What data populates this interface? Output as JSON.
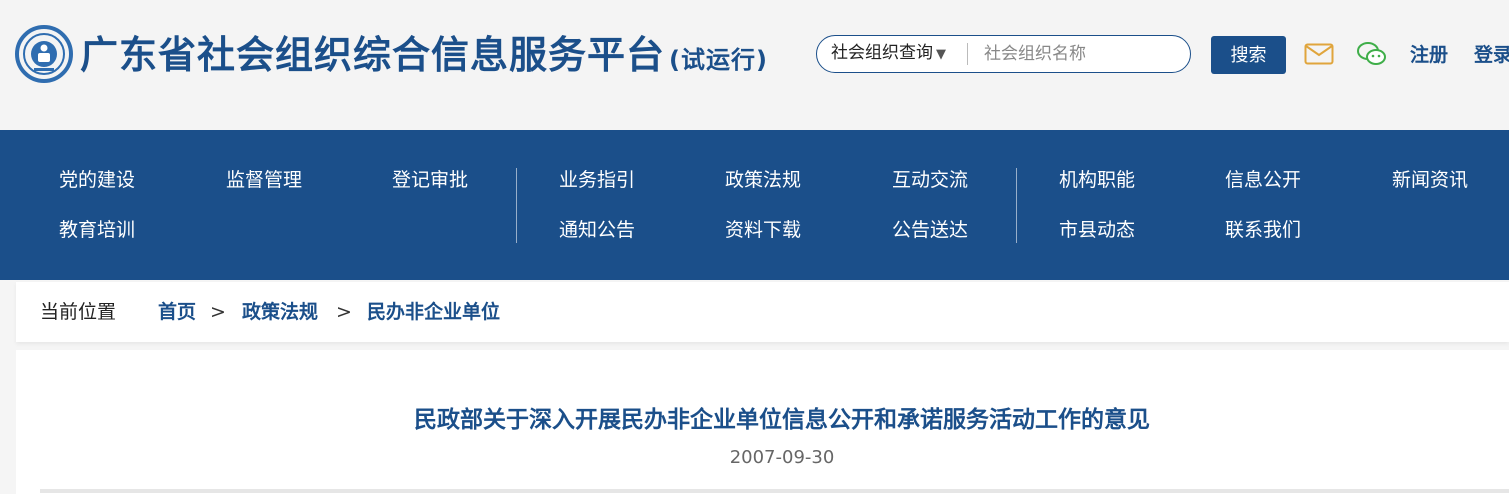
{
  "header": {
    "title": "广东省社会组织综合信息服务平台",
    "title_suffix": "(试运行)",
    "search": {
      "scope_label": "社会组织查询",
      "placeholder": "社会组织名称",
      "button_label": "搜索"
    },
    "icons": [
      "mail-icon",
      "wechat-icon"
    ],
    "register_label": "注册",
    "login_label": "登录",
    "colors": {
      "brand": "#1b4f8a",
      "mail_icon": "#e0a53c",
      "wechat_icon": "#3fae49"
    }
  },
  "nav": {
    "row1": [
      "党的建设",
      "监督管理",
      "登记审批",
      "业务指引",
      "政策法规",
      "互动交流",
      "机构职能",
      "信息公开",
      "新闻资讯"
    ],
    "row2": [
      "教育培训",
      "通知公告",
      "资料下载",
      "公告送达",
      "市县动态",
      "联系我们"
    ]
  },
  "breadcrumb": {
    "label": "当前位置",
    "items": [
      "首页",
      "政策法规",
      "民办非企业单位"
    ],
    "separator": ">"
  },
  "article": {
    "title": "民政部关于深入开展民办非企业单位信息公开和承诺服务活动工作的意见",
    "date": "2007-09-30"
  }
}
